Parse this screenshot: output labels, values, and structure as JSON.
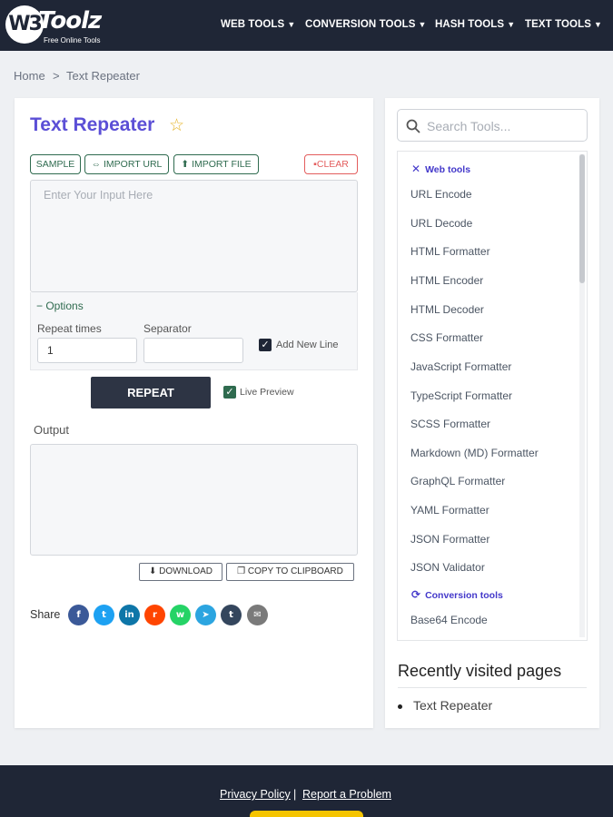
{
  "header": {
    "logo_mark": "W3",
    "logo_word": "Toolz",
    "logo_tagline": "Free Online Tools",
    "nav": [
      {
        "label": "WEB TOOLS"
      },
      {
        "label": "CONVERSION TOOLS"
      },
      {
        "label": "HASH TOOLS"
      },
      {
        "label": "TEXT TOOLS"
      }
    ]
  },
  "breadcrumb": {
    "home": "Home",
    "separator": ">",
    "current": "Text Repeater"
  },
  "main": {
    "title": "Text Repeater",
    "star_icon": "☆",
    "buttons": {
      "sample": "SAMPLE",
      "import_url": "IMPORT URL",
      "import_file": "IMPORT FILE",
      "clear": "CLEAR"
    },
    "input": {
      "placeholder": "Enter Your Input Here",
      "value": ""
    },
    "options": {
      "toggle_label": "Options",
      "repeat_times_label": "Repeat times",
      "repeat_times_value": "1",
      "separator_label": "Separator",
      "separator_value": "",
      "add_new_line_label": "Add New Line",
      "add_new_line_checked": true
    },
    "repeat_button": "REPEAT",
    "live_preview_label": "Live Preview",
    "live_preview_checked": true,
    "output_label": "Output",
    "output_value": "",
    "download_button": "DOWNLOAD",
    "copy_button": "COPY TO CLIPBOARD",
    "share_label": "Share",
    "share_icons": [
      {
        "name": "facebook-icon",
        "glyph": "f",
        "color": "#3b5998"
      },
      {
        "name": "twitter-icon",
        "glyph": "t",
        "color": "#1da1f2"
      },
      {
        "name": "linkedin-icon",
        "glyph": "in",
        "color": "#0e76a8"
      },
      {
        "name": "reddit-icon",
        "glyph": "r",
        "color": "#ff4500"
      },
      {
        "name": "whatsapp-icon",
        "glyph": "w",
        "color": "#25d366"
      },
      {
        "name": "telegram-icon",
        "glyph": "➤",
        "color": "#2ca5e0"
      },
      {
        "name": "tumblr-icon",
        "glyph": "t",
        "color": "#34465d"
      },
      {
        "name": "email-icon",
        "glyph": "✉",
        "color": "#7a7a7a"
      }
    ]
  },
  "sidebar": {
    "search_placeholder": "Search Tools...",
    "categories": [
      {
        "label": "Web tools",
        "icon": "tools-icon"
      },
      {
        "label": "Conversion tools",
        "icon": "sync-icon"
      }
    ],
    "tools": [
      "URL Encode",
      "URL Decode",
      "HTML Formatter",
      "HTML Encoder",
      "HTML Decoder",
      "CSS Formatter",
      "JavaScript Formatter",
      "TypeScript Formatter",
      "SCSS Formatter",
      "Markdown (MD) Formatter",
      "GraphQL Formatter",
      "YAML Formatter",
      "JSON Formatter",
      "JSON Validator",
      "Base64 Encode"
    ],
    "recent_heading": "Recently visited pages",
    "recent_items": [
      "Text Repeater"
    ]
  },
  "footer": {
    "privacy": "Privacy Policy",
    "separator": "|",
    "report": "Report a Problem"
  },
  "colors": {
    "header_bg": "#1f2636",
    "title_accent": "#5b4fd6",
    "button_green": "#2f6b4f",
    "button_red": "#e35d5d",
    "category_blue": "#4338ca"
  }
}
